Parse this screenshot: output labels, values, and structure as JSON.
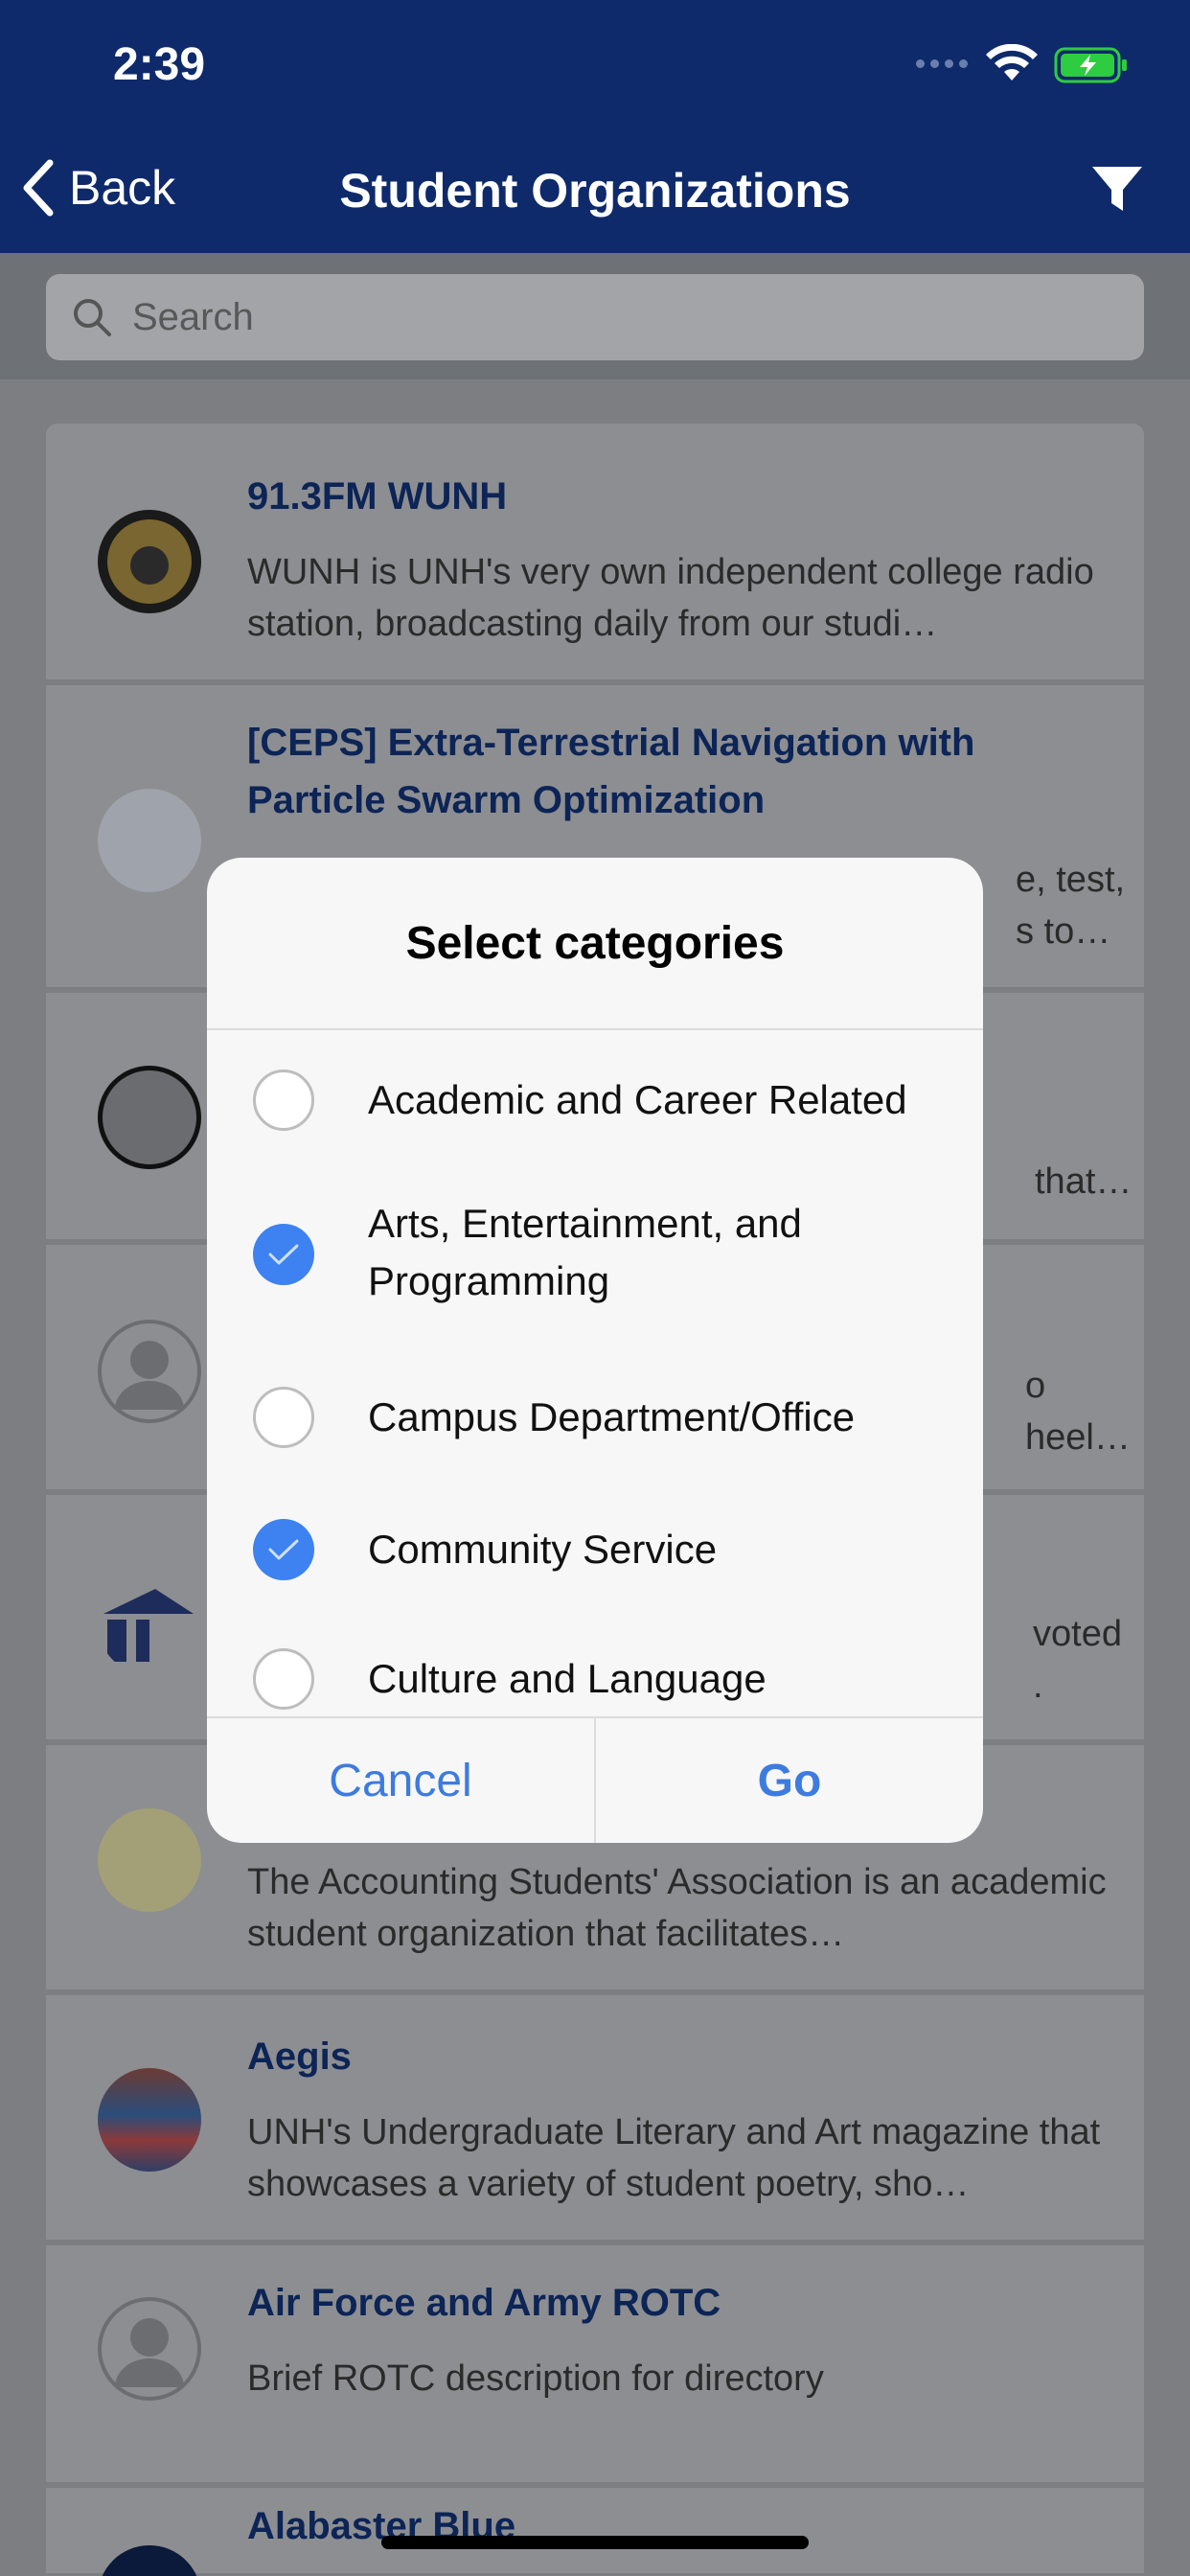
{
  "status_bar": {
    "time": "2:39"
  },
  "nav": {
    "back_label": "Back",
    "title": "Student Organizations"
  },
  "search": {
    "placeholder": "Search"
  },
  "organizations": [
    {
      "name": "91.3FM WUNH",
      "desc": "WUNH is UNH's very own independent college radio station, broadcasting daily from our studi…"
    },
    {
      "name": "[CEPS] Extra-Terrestrial Navigation with Particle Swarm Optimization",
      "desc_partial_1": "e, test,",
      "desc_partial_2": "s to…"
    },
    {
      "desc_partial": "that…"
    },
    {
      "desc_partial_1": "o",
      "desc_partial_2": "heel…"
    },
    {
      "desc_partial_1": "voted",
      "desc_partial_2": "."
    },
    {
      "desc": "The Accounting Students' Association is an academic student organization that facilitates…"
    },
    {
      "name": "Aegis",
      "desc": "UNH's Undergraduate Literary and Art magazine that showcases a variety of student poetry, sho…"
    },
    {
      "name": "Air Force and Army ROTC",
      "desc": "Brief ROTC description for directory"
    },
    {
      "name": "Alabaster Blue"
    }
  ],
  "dialog": {
    "title": "Select categories",
    "options": [
      {
        "label": "Academic and Career Related",
        "checked": false
      },
      {
        "label": "Arts, Entertainment, and Programming",
        "checked": true
      },
      {
        "label": "Campus Department/Office",
        "checked": false
      },
      {
        "label": "Community Service",
        "checked": true
      },
      {
        "label": "Culture and Language",
        "checked": false
      }
    ],
    "cancel_label": "Cancel",
    "go_label": "Go"
  },
  "colors": {
    "nav_bg": "#0e2a6b",
    "accent": "#3d82f0",
    "org_name": "#0c2456"
  }
}
